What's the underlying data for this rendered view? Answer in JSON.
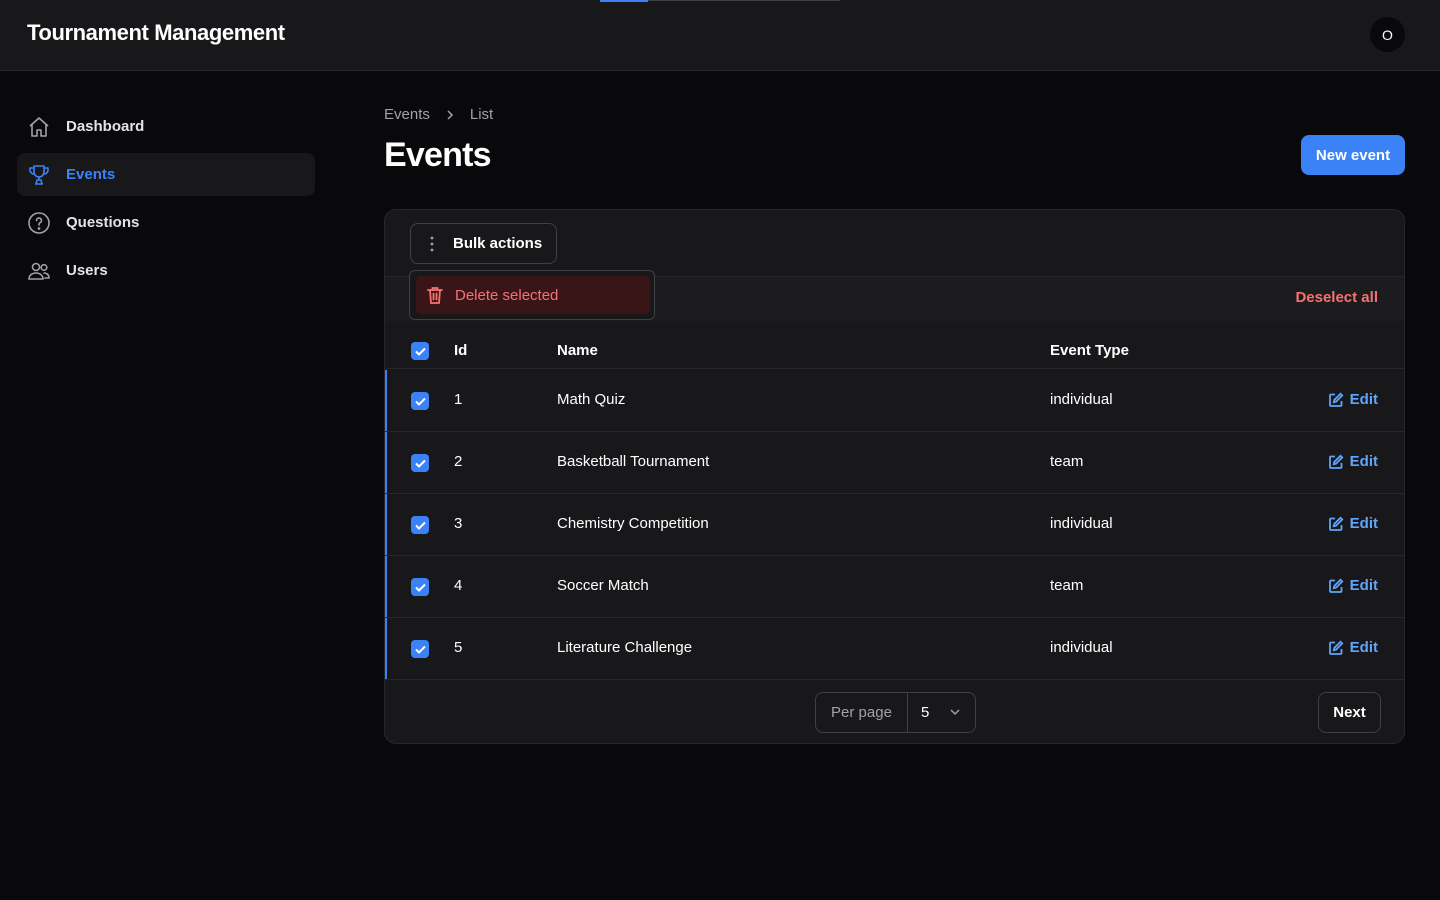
{
  "header": {
    "app_title": "Tournament Management",
    "avatar_initial": "O"
  },
  "sidebar": {
    "items": [
      {
        "label": "Dashboard",
        "icon": "home-icon"
      },
      {
        "label": "Events",
        "icon": "trophy-icon",
        "active": true
      },
      {
        "label": "Questions",
        "icon": "question-circle-icon"
      },
      {
        "label": "Users",
        "icon": "users-icon"
      }
    ]
  },
  "breadcrumb": {
    "parent": "Events",
    "current": "List"
  },
  "page": {
    "title": "Events",
    "new_button": "New event"
  },
  "toolbar": {
    "bulk_actions": "Bulk actions",
    "deselect_all": "Deselect all"
  },
  "dropdown": {
    "delete_selected": "Delete selected"
  },
  "table": {
    "columns": [
      "Id",
      "Name",
      "Event Type"
    ],
    "edit_label": "Edit",
    "rows": [
      {
        "id": "1",
        "name": "Math Quiz",
        "type": "individual",
        "selected": true
      },
      {
        "id": "2",
        "name": "Basketball Tournament",
        "type": "team",
        "selected": true
      },
      {
        "id": "3",
        "name": "Chemistry Competition",
        "type": "individual",
        "selected": true
      },
      {
        "id": "4",
        "name": "Soccer Match",
        "type": "team",
        "selected": true
      },
      {
        "id": "5",
        "name": "Literature Challenge",
        "type": "individual",
        "selected": true
      }
    ]
  },
  "pagination": {
    "per_page_label": "Per page",
    "per_page_value": "5",
    "next_label": "Next"
  },
  "colors": {
    "accent": "#3b82f6",
    "danger": "#f87171",
    "background": "#09090b",
    "surface": "#18181b"
  }
}
